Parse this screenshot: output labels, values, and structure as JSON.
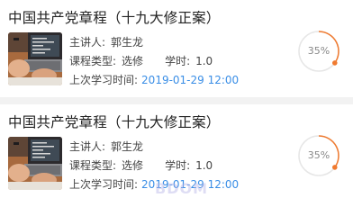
{
  "courses": [
    {
      "title": "中国共产党章程（十九大修正案）",
      "lecturer_label": "主讲人:",
      "lecturer": "郭生龙",
      "type_label": "课程类型:",
      "type": "选修",
      "hours_label": "学时:",
      "hours": "1.0",
      "last_study_label": "上次学习时间:",
      "last_study_time": "2019-01-29 12:00",
      "progress_text": "35%",
      "progress": 0.35
    },
    {
      "title": "中国共产党章程（十九大修正案）",
      "lecturer_label": "主讲人:",
      "lecturer": "郭生龙",
      "type_label": "课程类型:",
      "type": "选修",
      "hours_label": "学时:",
      "hours": "1.0",
      "last_study_label": "上次学习时间:",
      "last_study_time": "2019-01-29 12:00",
      "progress_text": "35%",
      "progress": 0.35
    }
  ],
  "colors": {
    "accent": "#f07a2f",
    "ring_track": "#e6e6e6",
    "time_blue": "#3a8ee6",
    "watermark": "#b8b4e8"
  },
  "watermark_text": "BDOM"
}
